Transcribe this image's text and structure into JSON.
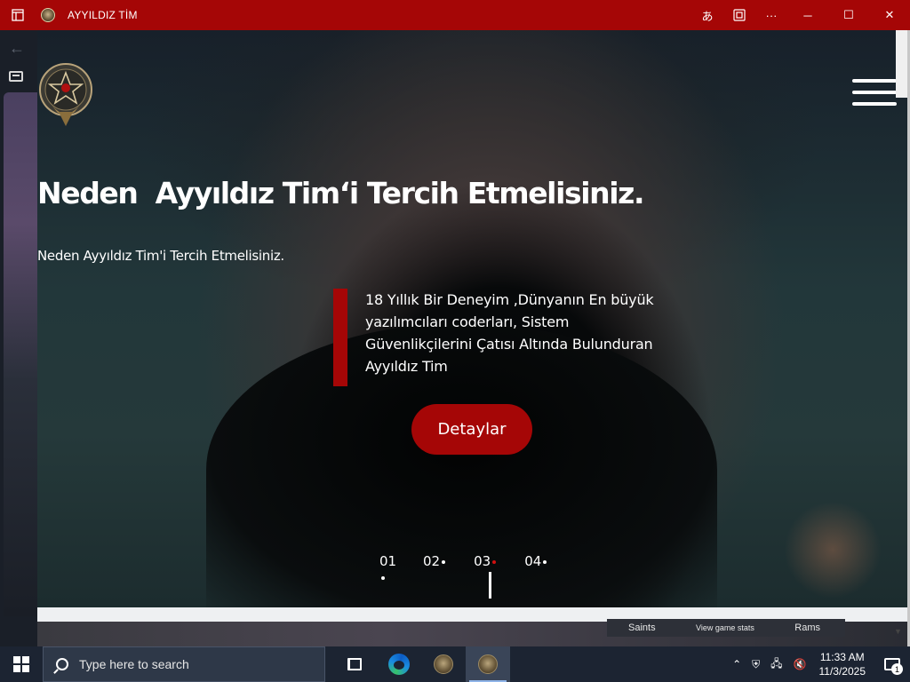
{
  "window": {
    "title": "AYYILDIZ TİM",
    "controls": {
      "translate": "あ",
      "minimize": "─",
      "maximize": "☐",
      "close": "✕"
    }
  },
  "hero": {
    "title": "Neden  Ayyıldız Tim‘i Tercih Etmelisiniz.",
    "subtitle": "Neden Ayyıldız Tim'i Tercih Etmelisiniz.",
    "quote": "18 Yıllık Bir Deneyim ,Dünyanın En büyük yazılımcıları coderları, Sistem Güvenlikçilerini Çatısı Altında Bulunduran Ayyıldız Tim",
    "cta_label": "Detaylar",
    "slides": [
      {
        "label": "01",
        "active": false
      },
      {
        "label": "02",
        "active": false
      },
      {
        "label": "03",
        "active": true
      },
      {
        "label": "04",
        "active": false
      }
    ]
  },
  "background_widget": {
    "team_left": "Saints",
    "link": "View game stats",
    "team_right": "Rams"
  },
  "taskbar": {
    "search_placeholder": "Type here to search",
    "time": "11:33 AM",
    "date": "11/3/2025",
    "notification_count": "1"
  },
  "colors": {
    "brand_red": "#a50606",
    "taskbar": "#1c2432"
  }
}
